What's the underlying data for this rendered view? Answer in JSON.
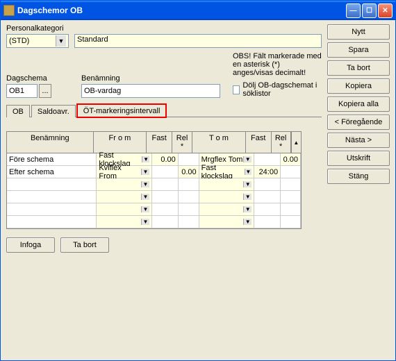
{
  "window": {
    "title": "Dagschemor OB"
  },
  "labels": {
    "personalkategori": "Personalkategori",
    "dagschema": "Dagschema",
    "benamning": "Benämning",
    "note": "OBS! Fält markerade med en asterisk (*) anges/visas decimalt!",
    "checkbox": "Dölj OB-dagschemat i söklistor"
  },
  "fields": {
    "personalkategori": "(STD)",
    "standard_text": "Standard",
    "dagschema": "OB1",
    "benamning": "OB-vardag"
  },
  "tabs": {
    "t1": "OB",
    "t2": "Saldoavr.",
    "t3": "ÖT-markeringsintervall"
  },
  "grid": {
    "headers": {
      "name": "Benämning",
      "from": "Fr o m",
      "fast": "Fast",
      "rel": "Rel *",
      "to": "T o m",
      "fast2": "Fast",
      "rel2": "Rel *"
    },
    "rows": [
      {
        "name": "Före schema",
        "from": "Fast klockslag",
        "fast": "0.00",
        "rel": "",
        "to": "Mrgflex Tom",
        "fast2": "",
        "rel2": "0.00"
      },
      {
        "name": "Efter schema",
        "from": "Kvlflex From",
        "fast": "",
        "rel": "0.00",
        "to": "Fast klockslag",
        "fast2": "24:00",
        "rel2": ""
      }
    ]
  },
  "buttons": {
    "infoga": "Infoga",
    "tabort_local": "Ta bort",
    "nytt": "Nytt",
    "spara": "Spara",
    "tabort": "Ta bort",
    "kopiera": "Kopiera",
    "kopiera_alla": "Kopiera alla",
    "foregaende": "< Föregående",
    "nasta": "Nästa >",
    "utskrift": "Utskrift",
    "stang": "Stäng"
  }
}
